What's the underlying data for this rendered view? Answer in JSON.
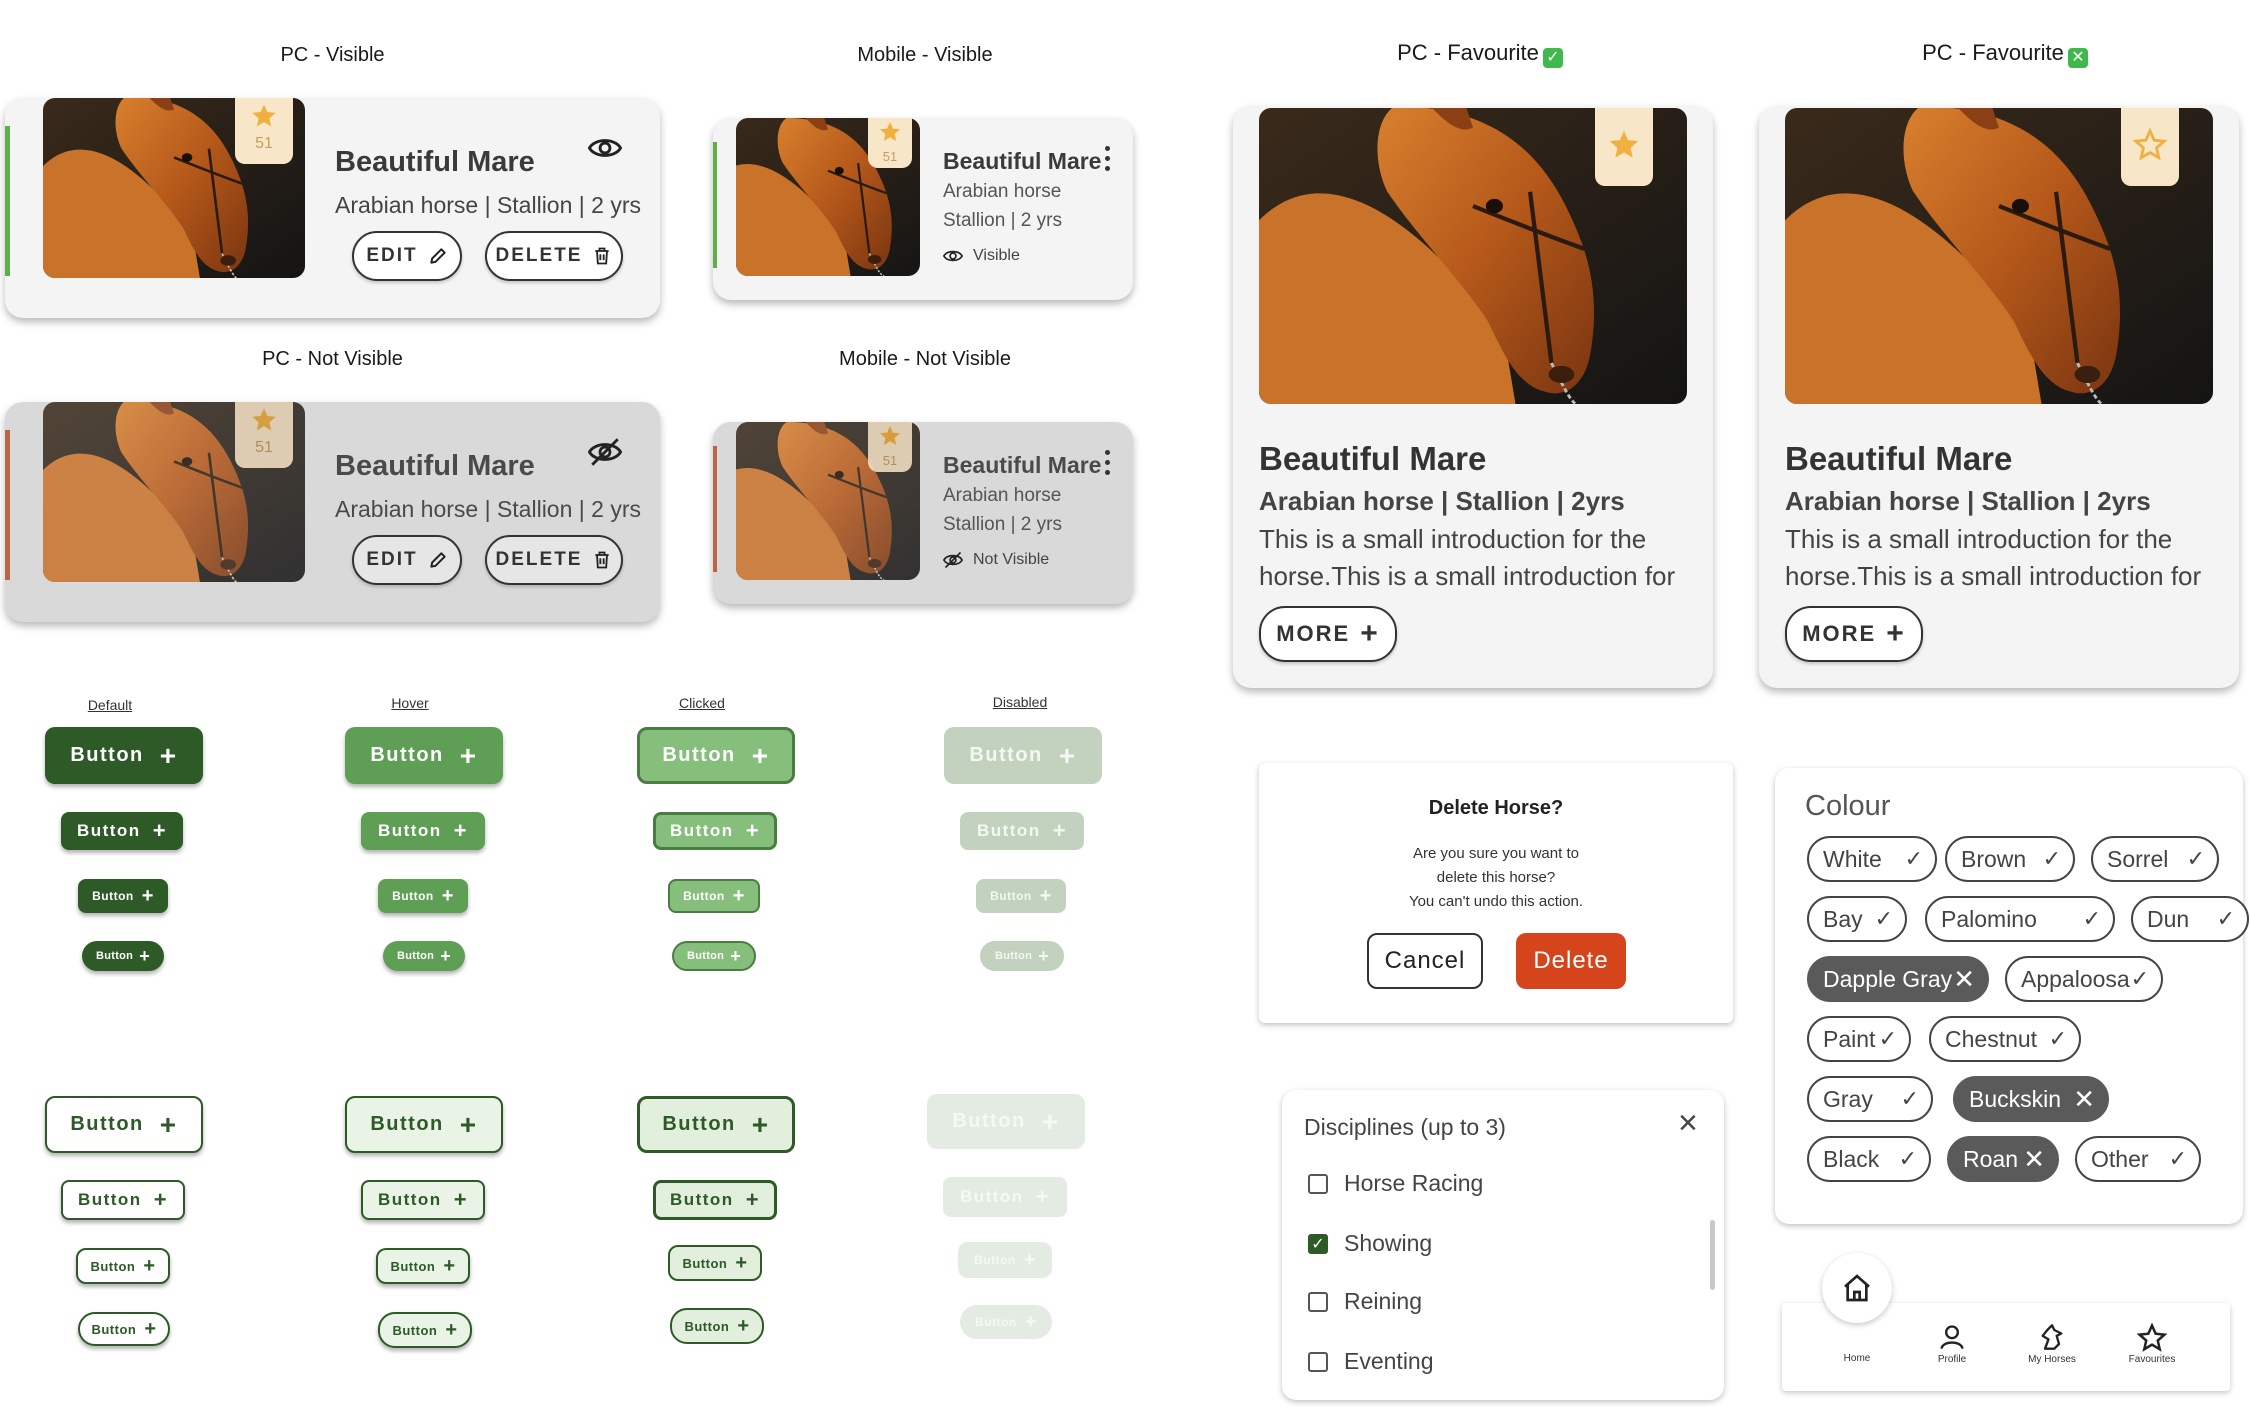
{
  "sections": {
    "pc_visible": "PC - Visible",
    "mobile_visible": "Mobile - Visible",
    "pc_fav_on": "PC - Favourite",
    "pc_fav_off": "PC - Favourite",
    "pc_not_visible": "PC - Not Visible",
    "mobile_not_visible": "Mobile - Not Visible"
  },
  "horse": {
    "name": "Beautiful Mare",
    "details_pc": "Arabian horse | Stallion | 2 yrs",
    "breed": "Arabian horse",
    "sex_age": "Stallion | 2 yrs",
    "details_fav": "Arabian horse | Stallion | 2yrs",
    "intro_line1": "This is a small introduction for the",
    "intro_line2": "horse.This is a small introduction for",
    "fav_count": "51"
  },
  "actions": {
    "edit": "EDIT",
    "delete": "DELETE",
    "more": "MORE",
    "visible": "Visible",
    "not_visible": "Not Visible"
  },
  "button_states": {
    "default": "Default",
    "hover": "Hover",
    "clicked": "Clicked",
    "disabled": "Disabled",
    "label": "Button"
  },
  "delete_dialog": {
    "title": "Delete Horse?",
    "line1": "Are you sure you want to",
    "line2": "delete this horse?",
    "line3": "You can't undo this action.",
    "cancel": "Cancel",
    "confirm": "Delete"
  },
  "disciplines": {
    "title": "Disciplines (up to 3)",
    "options": [
      {
        "label": "Horse Racing",
        "checked": false
      },
      {
        "label": "Showing",
        "checked": true
      },
      {
        "label": "Reining",
        "checked": false
      },
      {
        "label": "Eventing",
        "checked": false
      }
    ]
  },
  "colour": {
    "title": "Colour",
    "chips": [
      {
        "label": "White",
        "selected": false
      },
      {
        "label": "Brown",
        "selected": false
      },
      {
        "label": "Sorrel",
        "selected": false
      },
      {
        "label": "Bay",
        "selected": false
      },
      {
        "label": "Palomino",
        "selected": false
      },
      {
        "label": "Dun",
        "selected": false
      },
      {
        "label": "Dapple Gray",
        "selected": true
      },
      {
        "label": "Appaloosa",
        "selected": false
      },
      {
        "label": "Paint",
        "selected": false
      },
      {
        "label": "Chestnut",
        "selected": false
      },
      {
        "label": "Gray",
        "selected": false
      },
      {
        "label": "Buckskin",
        "selected": true
      },
      {
        "label": "Black",
        "selected": false
      },
      {
        "label": "Roan",
        "selected": true
      },
      {
        "label": "Other",
        "selected": false
      }
    ]
  },
  "bottom_nav": {
    "home": "Home",
    "profile": "Profile",
    "my_horses": "My Horses",
    "favourites": "Favourites"
  },
  "colors": {
    "green_dark": "#2d5a27",
    "green_hover": "#5f9e55",
    "green_clicked": "#86be7c",
    "green_disabled": "#c2d2bf",
    "green_light_bg": "#eaf4e6",
    "delete_red": "#d6441c",
    "visible_stripe": "#5fae4e",
    "not_visible_stripe": "#b8654a",
    "star": "#f0b040"
  }
}
